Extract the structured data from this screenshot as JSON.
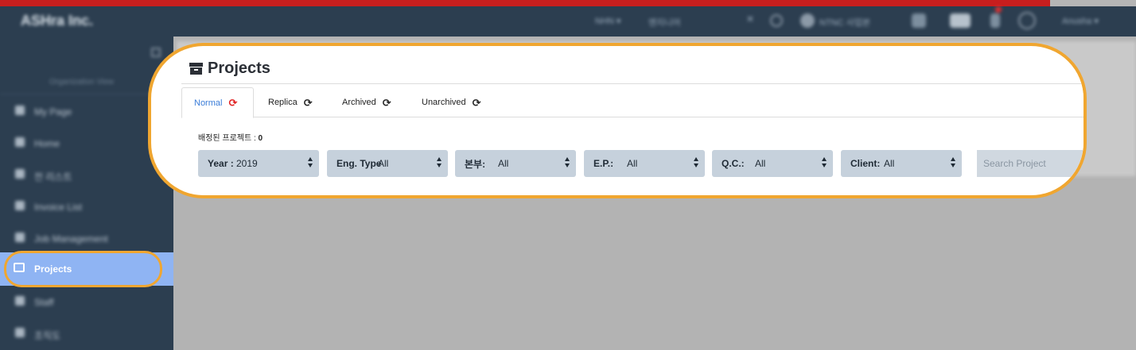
{
  "topbar": {
    "brand": "ASHra Inc.",
    "items": [
      "NHN ▾",
      "엔지니어"
    ],
    "user_chip": "NTNC 사업본",
    "profile": "Anusha ▾"
  },
  "sidebar": {
    "org_label": "Organization View",
    "items": [
      {
        "label": "My Page"
      },
      {
        "label": "Home"
      },
      {
        "label": "전 리스트"
      },
      {
        "label": "Invoice List"
      },
      {
        "label": "Job Management"
      },
      {
        "label": "Projects",
        "active": true
      },
      {
        "label": "Staff"
      },
      {
        "label": "조직도"
      }
    ]
  },
  "page": {
    "title": "Projects",
    "tabs": [
      {
        "label": "Normal",
        "active": true
      },
      {
        "label": "Replica"
      },
      {
        "label": "Archived"
      },
      {
        "label": "Unarchived"
      }
    ],
    "assigned_label": "배정된 프로젝트 :",
    "assigned_count": "0"
  },
  "filters": [
    {
      "label": "Year :",
      "value": "2019"
    },
    {
      "label": "Eng. Type",
      "value": "All"
    },
    {
      "label": "본부:",
      "value": "All"
    },
    {
      "label": "E.P.:",
      "value": "All"
    },
    {
      "label": "Q.C.:",
      "value": "All"
    },
    {
      "label": "Client:",
      "value": "All"
    }
  ],
  "search": {
    "placeholder": "Search Project"
  },
  "colors": {
    "accent_ring": "#f0a630",
    "sidebar_bg": "#2c3e50",
    "sidebar_active": "#8fb4f3",
    "filter_bg": "#c6d1dc",
    "active_tab_text": "#3b7dd8",
    "refresh_active": "#e02020"
  },
  "icons": {
    "title": "archive-box-icon",
    "tab": "refresh-icon",
    "sidebar_active": "projects-icon"
  }
}
